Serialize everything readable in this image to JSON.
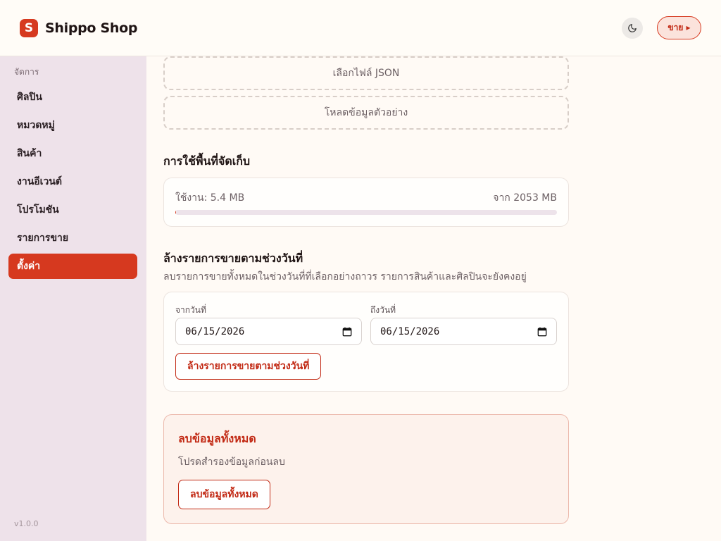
{
  "header": {
    "logo_glyph": "S",
    "app_name": "Shippo Shop",
    "theme_icon": "moon-icon",
    "sell_label": "ขาย ▸"
  },
  "sidebar": {
    "section_label": "จัดการ",
    "items": [
      {
        "label": "ศิลปิน"
      },
      {
        "label": "หมวดหมู่"
      },
      {
        "label": "สินค้า"
      },
      {
        "label": "งานอีเวนต์"
      },
      {
        "label": "โปรโมชัน"
      },
      {
        "label": "รายการขาย"
      },
      {
        "label": "ตั้งค่า",
        "active": true
      }
    ],
    "version": "v1.0.0"
  },
  "main": {
    "import": {
      "choose_json": "เลือกไฟล์ JSON",
      "load_sample": "โหลดข้อมูลตัวอย่าง"
    },
    "storage": {
      "title": "การใช้พื้นที่จัดเก็บ",
      "used": "ใช้งาน: 5.4 MB",
      "total": "จาก 2053 MB",
      "fraction_used": 0.0026
    },
    "clear_range": {
      "title": "ล้างรายการขายตามช่วงวันที่",
      "description": "ลบรายการขายทั้งหมดในช่วงวันที่ที่เลือกอย่างถาวร รายการสินค้าและศิลปินจะยังคงอยู่",
      "from_label": "จากวันที่",
      "from_value": "06/15/2026",
      "to_label": "ถึงวันที่",
      "to_value": "06/15/2026",
      "button_label": "ล้างรายการขายตามช่วงวันที่"
    },
    "danger": {
      "title": "ลบข้อมูลทั้งหมด",
      "description": "โปรดสำรองข้อมูลก่อนลบ",
      "button_label": "ลบข้อมูลทั้งหมด"
    }
  },
  "colors": {
    "accent": "#d6391f",
    "sidebar_bg": "#eee2ea",
    "page_bg": "#fffaf5"
  }
}
